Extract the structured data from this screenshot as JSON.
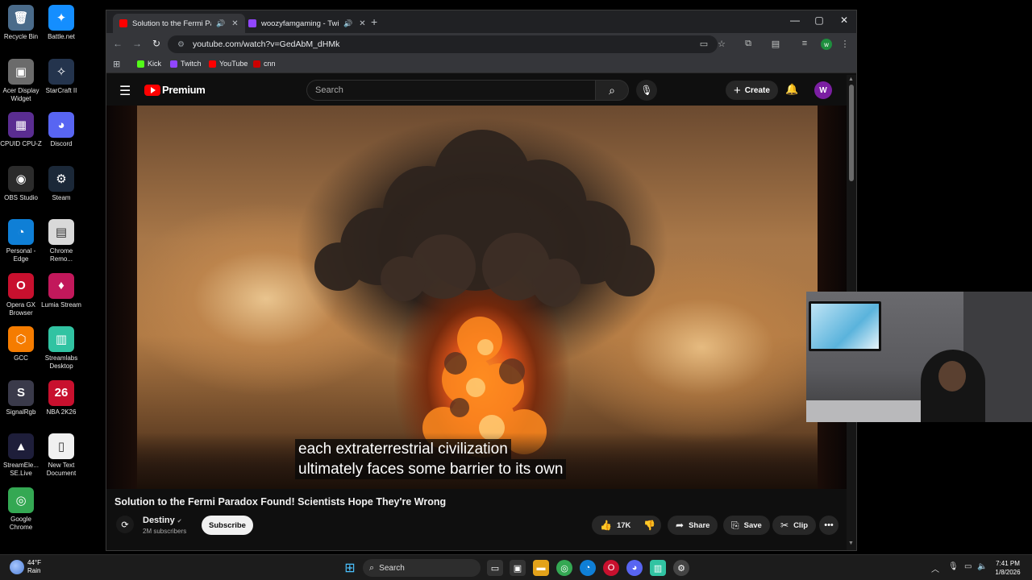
{
  "desktop": {
    "icons": [
      {
        "label": "Recycle Bin",
        "glyph": "🗑",
        "color": "#4a6b8a"
      },
      {
        "label": "Battle.net",
        "glyph": "✦",
        "color": "#148eff"
      },
      {
        "label": "Acer Display Widget",
        "glyph": "▣",
        "color": "#6b6b6b"
      },
      {
        "label": "StarCraft II",
        "glyph": "✧",
        "color": "#24344d"
      },
      {
        "label": "CPUID CPU-Z",
        "glyph": "▦",
        "color": "#5a2d91"
      },
      {
        "label": "Discord",
        "glyph": "◕",
        "color": "#5865f2"
      },
      {
        "label": "OBS Studio",
        "glyph": "◉",
        "color": "#2b2b2b"
      },
      {
        "label": "Steam",
        "glyph": "⚙",
        "color": "#1b2838"
      },
      {
        "label": "Personal - Edge",
        "glyph": "◔",
        "color": "#0f7fd6"
      },
      {
        "label": "Chrome Remo...",
        "glyph": "▤",
        "color": "#d9d9d9"
      },
      {
        "label": "Opera GX Browser",
        "glyph": "O",
        "color": "#c8102e"
      },
      {
        "label": "Lumia Stream",
        "glyph": "♦",
        "color": "#c2185b"
      },
      {
        "label": "GCC",
        "glyph": "⬡",
        "color": "#f57c00"
      },
      {
        "label": "Streamlabs Desktop",
        "glyph": "▥",
        "color": "#31c3a2"
      },
      {
        "label": "SignalRgb",
        "glyph": "S",
        "color": "#3a3a4a"
      },
      {
        "label": "NBA 2K26",
        "glyph": "26",
        "color": "#c8102e"
      },
      {
        "label": "StreamEle... SE.Live",
        "glyph": "▲",
        "color": "#1e1e3a"
      },
      {
        "label": "New Text Document",
        "glyph": "▯",
        "color": "#f0f0f0"
      },
      {
        "label": "Google Chrome",
        "glyph": "◎",
        "color": "#34a853"
      }
    ]
  },
  "browser": {
    "tabs": [
      {
        "title": "Solution to the Fermi Parad",
        "favicon_color": "#ff0000",
        "active": true
      },
      {
        "title": "woozyfamgaming - Twitch",
        "favicon_color": "#9146ff",
        "active": false
      }
    ],
    "address": "youtube.com/watch?v=GedAbM_dHMk",
    "bookmarks": [
      {
        "label": "Kick",
        "color": "#53fc18"
      },
      {
        "label": "Twitch",
        "color": "#9146ff"
      },
      {
        "label": "YouTube",
        "color": "#ff0000"
      },
      {
        "label": "cnn",
        "color": "#cc0000"
      }
    ],
    "profile_initial": "w"
  },
  "youtube": {
    "logo_text": "Premium",
    "search_placeholder": "Search",
    "create_label": "Create",
    "avatar_initial": "W",
    "caption_lines": [
      "each extraterrestrial civilization",
      "ultimately faces some barrier to its own"
    ],
    "video_title": "Solution to the Fermi Paradox Found! Scientists Hope They're Wrong",
    "channel": {
      "name": "Destiny",
      "subscribers": "2M subscribers",
      "subscribe_label": "Subscribe"
    },
    "actions": {
      "likes": "17K",
      "share": "Share",
      "save": "Save",
      "clip": "Clip"
    }
  },
  "taskbar": {
    "weather_temp": "44°F",
    "weather_desc": "Rain",
    "search_label": "Search",
    "time": "7:41 PM",
    "date": "1/8/2026"
  }
}
